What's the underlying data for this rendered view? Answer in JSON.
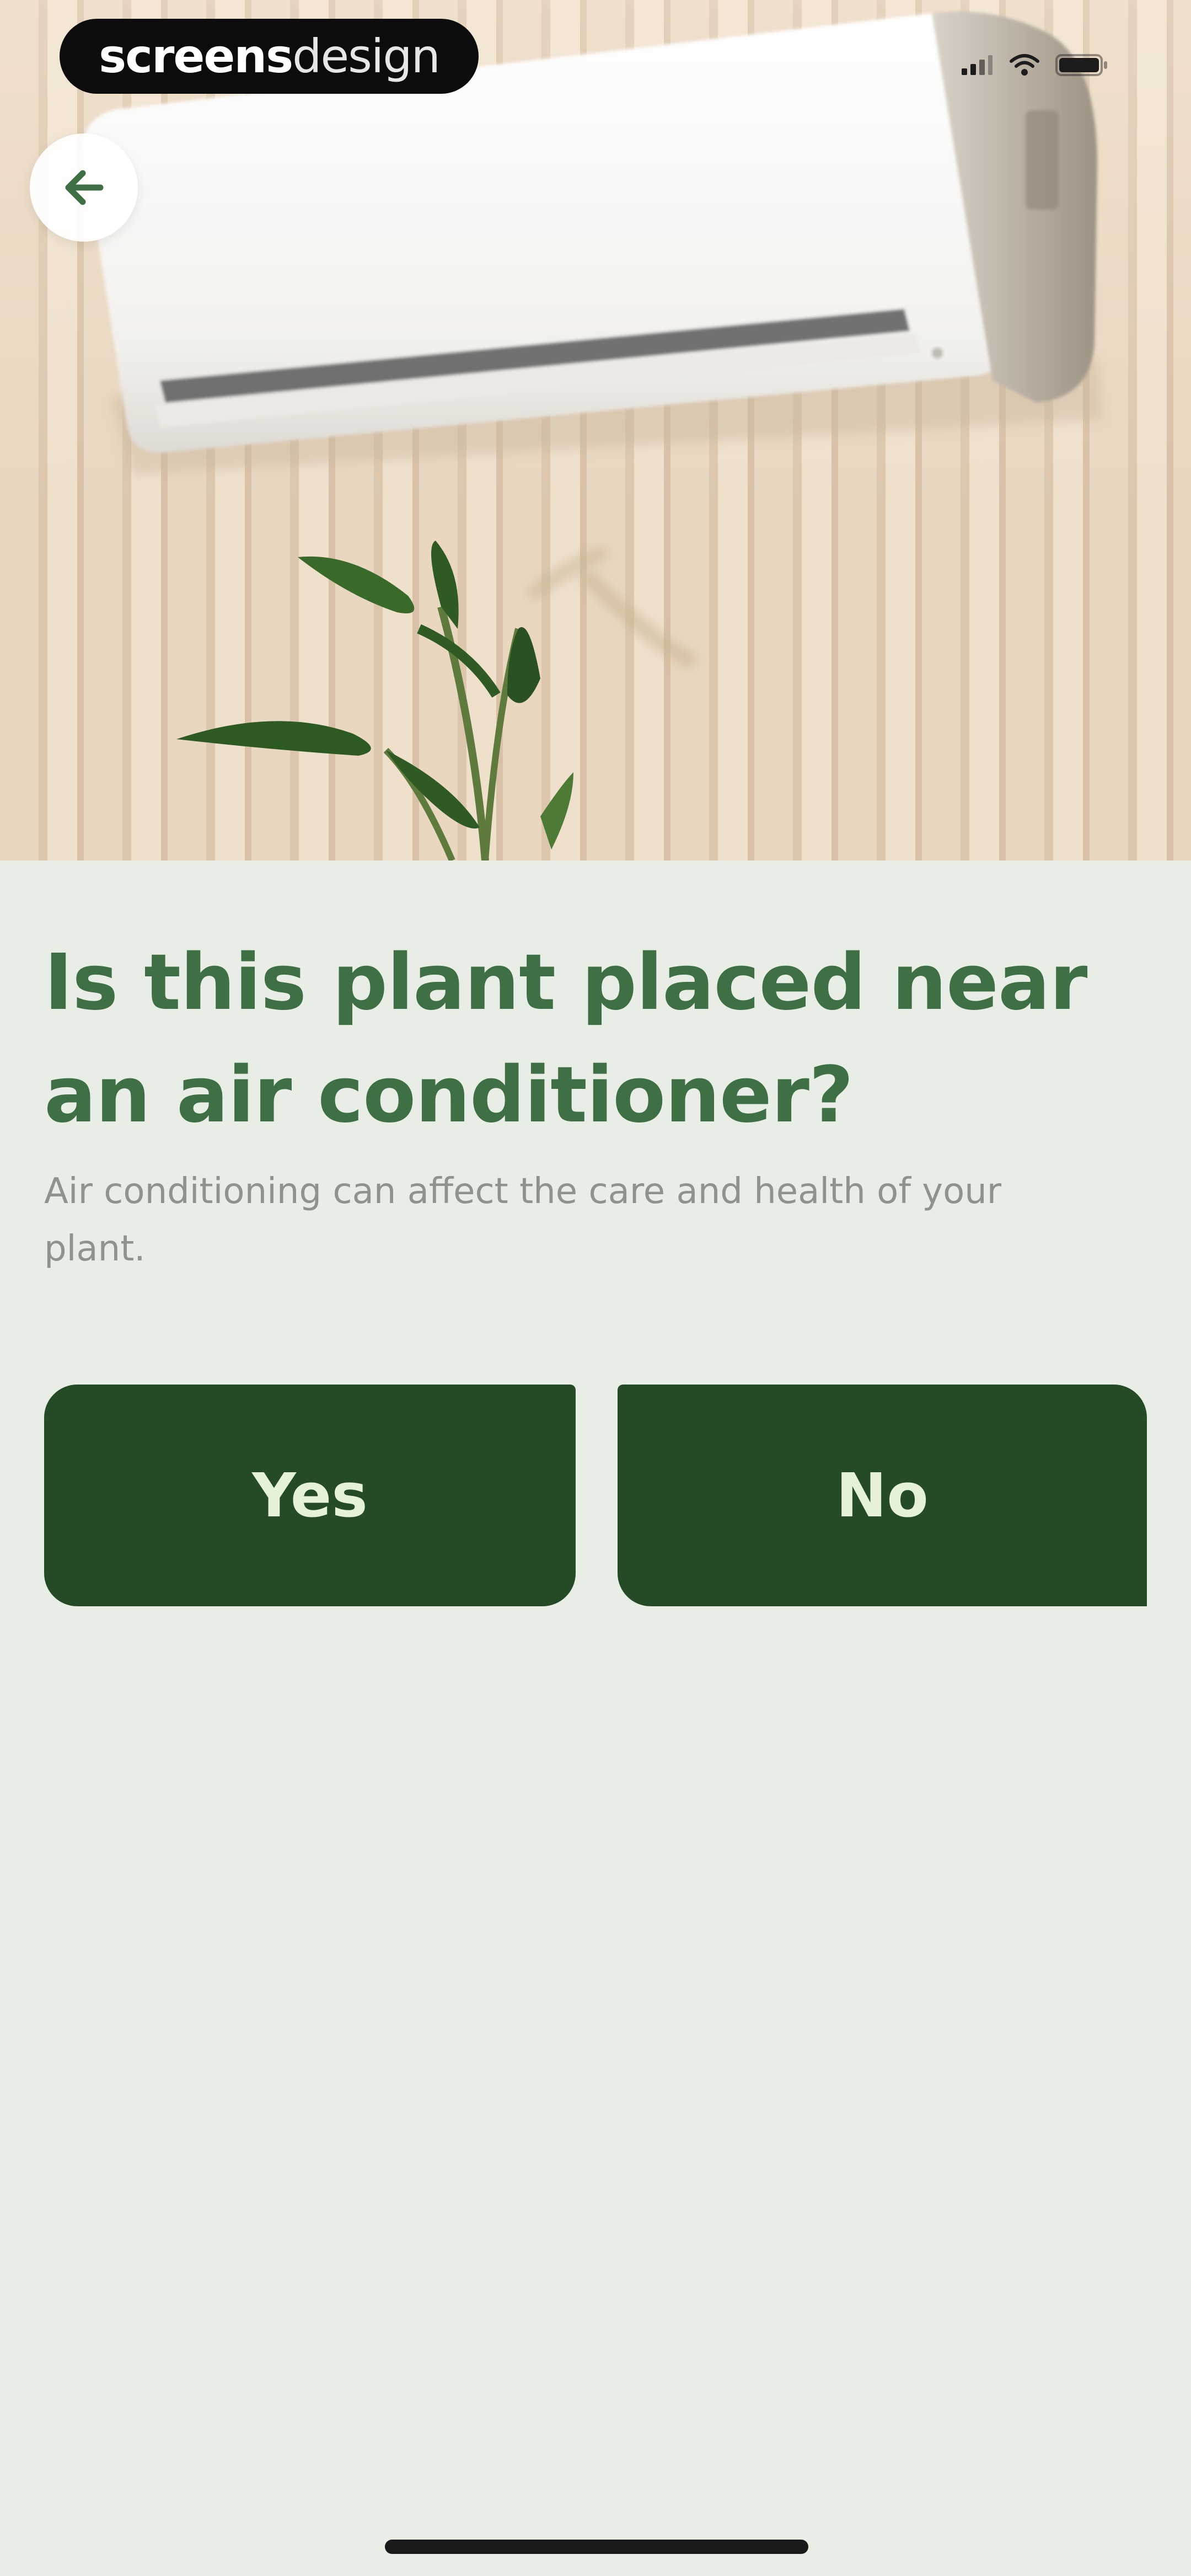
{
  "watermark": {
    "bold_part": "screens",
    "light_part": "design"
  },
  "status_bar": {
    "icons": [
      "signal-icon",
      "wifi-icon",
      "battery-icon"
    ]
  },
  "header": {
    "back_icon": "arrow-left-icon"
  },
  "question": {
    "title": "Is this plant placed near an air conditioner?",
    "subtitle": "Air conditioning can affect the care and health of your plant."
  },
  "answers": {
    "yes_label": "Yes",
    "no_label": "No"
  },
  "colors": {
    "background": "#e8ede6",
    "title_green": "#3f6f45",
    "button_green": "#244a26",
    "button_text": "#e6f2d8",
    "subtitle_gray": "#8c948c"
  }
}
